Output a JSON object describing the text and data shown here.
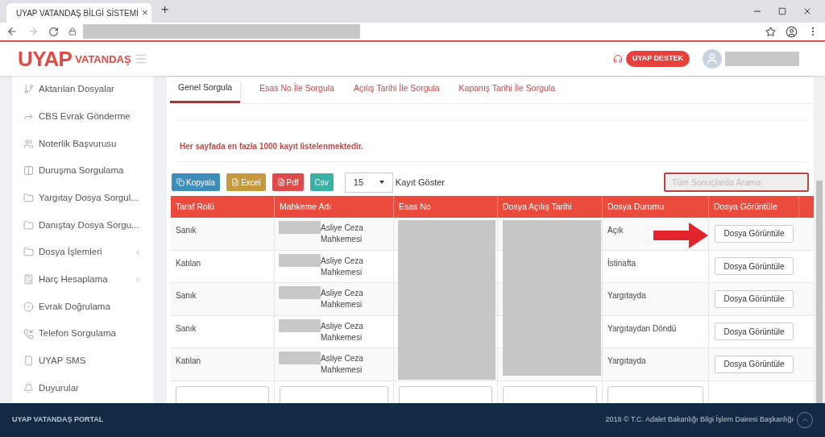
{
  "browser": {
    "tab_title": "UYAP VATANDAŞ BİLGİ SİSTEMİ",
    "tab_close": "×",
    "new_tab": "+"
  },
  "header": {
    "logo_main": "UYAP",
    "logo_sub": "VATANDAŞ",
    "support_button": "UYAP DESTEK"
  },
  "sidebar": {
    "items": [
      {
        "label": "Aktarılan Dosyalar",
        "kind": "transfer",
        "expandable": false
      },
      {
        "label": "CBS Evrak Gönderme",
        "kind": "send",
        "expandable": false
      },
      {
        "label": "Noterlik Başvurusu",
        "kind": "people",
        "expandable": false
      },
      {
        "label": "Duruşma Sorgulama",
        "kind": "columns",
        "expandable": false
      },
      {
        "label": "Yargıtay Dosya Sorgul...",
        "kind": "folder",
        "expandable": false
      },
      {
        "label": "Danıştay Dosya Sorgu...",
        "kind": "folder",
        "expandable": false
      },
      {
        "label": "Dosya İşlemleri",
        "kind": "folder",
        "expandable": true
      },
      {
        "label": "Harç Hesaplama",
        "kind": "calculator",
        "expandable": true
      },
      {
        "label": "Evrak Doğrulama",
        "kind": "check",
        "expandable": false
      },
      {
        "label": "Telefon Sorgulama",
        "kind": "phone",
        "expandable": false
      },
      {
        "label": "UYAP SMS",
        "kind": "mobile",
        "expandable": false
      },
      {
        "label": "Duyurular",
        "kind": "bell",
        "expandable": false
      }
    ]
  },
  "tabs": [
    {
      "label": "Genel Sorgula",
      "selected": true
    },
    {
      "label": "Esas No İle Sorgula",
      "selected": false
    },
    {
      "label": "Açılış Tarihi İle Sorgula",
      "selected": false
    },
    {
      "label": "Kapanış Tarihi İle Sorgula",
      "selected": false
    }
  ],
  "notice": "Her sayfada en fazla 1000 kayıt listelenmektedir.",
  "export_buttons": [
    {
      "label": "Kopyala",
      "kind": "copy",
      "color": "#3c8dbc"
    },
    {
      "label": "Excel",
      "kind": "excel",
      "color": "#c49a3c"
    },
    {
      "label": "Pdf",
      "kind": "pdf",
      "color": "#dd4b4b"
    },
    {
      "label": "Csv",
      "kind": "csv",
      "color": "#3bb0a4"
    }
  ],
  "page_size": {
    "value": "15",
    "label": "Kayıt Göster"
  },
  "search": {
    "placeholder": "Tüm Sonuçlarda Arama"
  },
  "table": {
    "columns": [
      "Taraf Rolü",
      "Mahkeme Adı",
      "Esas No",
      "Dosya Açılış Tarihi",
      "Dosya Durumu",
      "Dosya Görüntüle"
    ],
    "rows": [
      {
        "role": "Sanık",
        "court": "Asliye Ceza Mahkemesi",
        "status": "Açık",
        "action": "Dosya Görüntüle",
        "highlighted": true
      },
      {
        "role": "Katılan",
        "court": "Asliye Ceza Mahkemesi",
        "status": "İstinafta",
        "action": "Dosya Görüntüle",
        "highlighted": false
      },
      {
        "role": "Sanık",
        "court": "Asliye Ceza Mahkemesi",
        "status": "Yargıtayda",
        "action": "Dosya Görüntüle",
        "highlighted": false
      },
      {
        "role": "Sanık",
        "court": "Asliye Ceza Mahkemesi",
        "status": "Yargıtaydan Döndü",
        "action": "Dosya Görüntüle",
        "highlighted": false
      },
      {
        "role": "Katılan",
        "court": "Asliye Ceza Mahkemesi",
        "status": "Yargıtayda",
        "action": "Dosya Görüntüle",
        "highlighted": false
      }
    ]
  },
  "footer": {
    "left": "UYAP VATANDAŞ PORTAL",
    "right": "2018 © T.C. Adalet Bakanlığı Bilgi İşlem Dairesi Başkanlığı"
  }
}
